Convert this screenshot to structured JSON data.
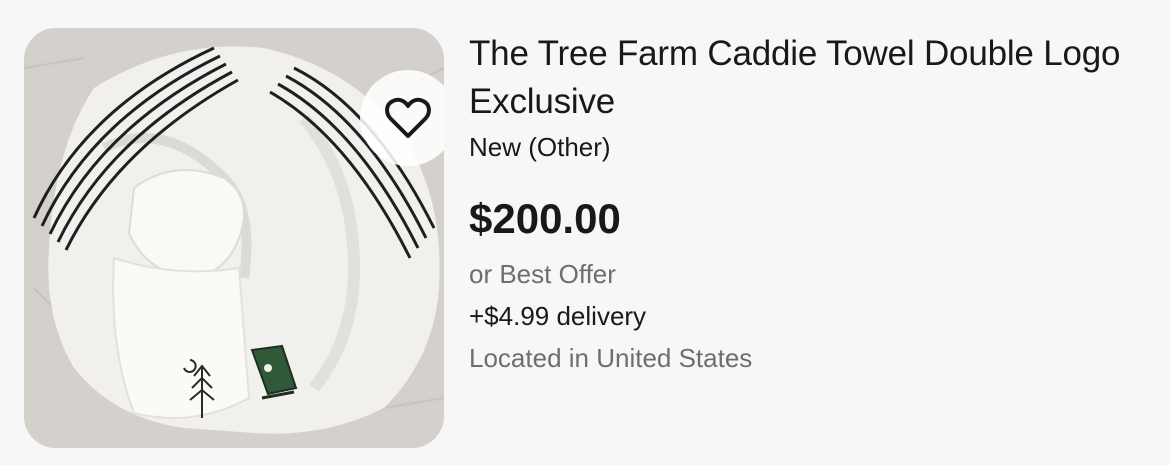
{
  "listing": {
    "title": "The Tree Farm Caddie Towel Double Logo Exclusive",
    "condition": "New (Other)",
    "price": "$200.00",
    "best_offer": "or Best Offer",
    "delivery": "+$4.99 delivery",
    "location": "Located in United States"
  },
  "watch_button": {
    "icon": "heart-outline-icon"
  },
  "colors": {
    "text_primary": "#191919",
    "text_secondary": "#6e6e6e",
    "background": "#f7f7f7"
  }
}
